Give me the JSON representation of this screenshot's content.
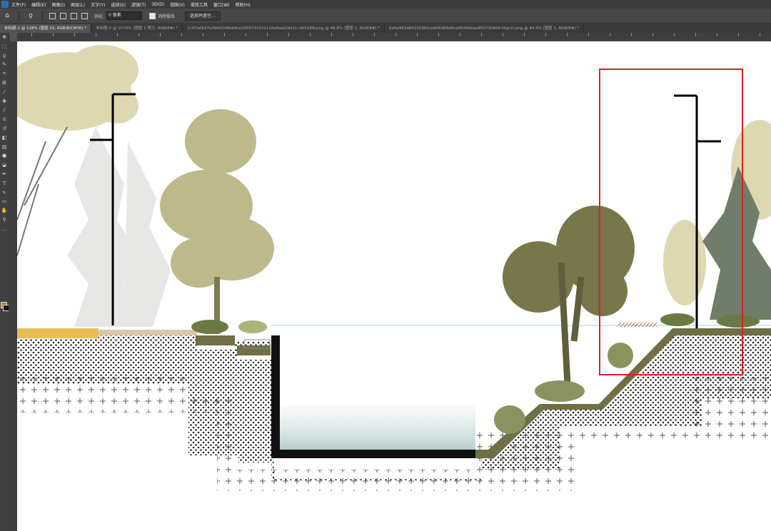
{
  "menu": [
    "文件(F)",
    "编辑(E)",
    "图像(I)",
    "图层(L)",
    "文字(Y)",
    "选择(S)",
    "滤镜(T)",
    "3D(D)",
    "视图(V)",
    "增效工具",
    "窗口(W)",
    "帮助(H)"
  ],
  "options": {
    "feather_label": "羽化:",
    "feather_value": "0 像素",
    "antialias_label": "消除锯齿",
    "select_mask_button": "选择并遮住..."
  },
  "tabs": [
    {
      "label": "未标题-1 @ 128% (图层 15, RGB/8/CMYK) *",
      "active": true
    },
    {
      "label": "未标题-2 @ 1570% (图层 1 拷贝, RGB/8#) *",
      "active": false
    },
    {
      "label": "1c07a0b37e3944144bb4ce335973225212defbab2de11-nN1GEN.png @ 48.8% (图层 1, RGB/8#) *",
      "active": false
    },
    {
      "label": "6e5a963d85102962ce806d69d0ce95466bae850730406-fXgc2l.png @ 44.4% (图层 1, RGB/8#) *",
      "active": false
    }
  ],
  "tools": [
    "move-tool",
    "artboard-tool",
    "lasso-tool",
    "quick-select-tool",
    "crop-tool",
    "frame-tool",
    "eyedropper-tool",
    "spot-heal-tool",
    "brush-tool",
    "stamp-tool",
    "history-brush-tool",
    "eraser-tool",
    "gradient-tool",
    "blur-tool",
    "dodge-tool",
    "pen-tool",
    "type-tool",
    "path-select-tool",
    "rectangle-tool",
    "hand-tool",
    "zoom-tool",
    "more-tools"
  ],
  "colors": {
    "foreground": "#c07b2a",
    "background": "#111111",
    "selection": "#e02020",
    "ground": "#6f6e45",
    "water": "#c3d6d5"
  }
}
